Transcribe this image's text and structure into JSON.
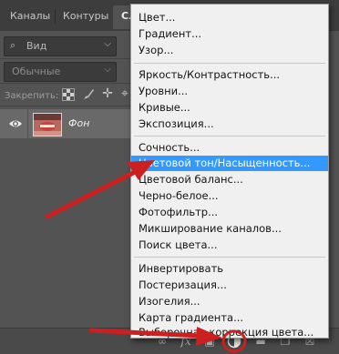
{
  "tabs": [
    "Каналы",
    "Контуры",
    "Сл"
  ],
  "filter": {
    "label": "Вид"
  },
  "blend_mode": {
    "value": "Обычные"
  },
  "lock": {
    "label": "Закрепить:"
  },
  "layer": {
    "name": "Фон"
  },
  "bottom_bar": {
    "fx_label": "fx"
  },
  "menu": {
    "items": [
      "Цвет...",
      "Градиент...",
      "Узор...",
      "Яркость/Контрастность...",
      "Уровни...",
      "Кривые...",
      "Экспозиция...",
      "Сочность...",
      "Цветовой тон/Насыщенность...",
      "Цветовой баланс...",
      "Черно-белое...",
      "Фотофильтр...",
      "Микширование каналов...",
      "Поиск цвета...",
      "Инвертировать",
      "Постеризация...",
      "Изогелия...",
      "Карта градиента...",
      "Выборочная коррекция цвета..."
    ],
    "highlighted": "Цветовой тон/Насыщенность..."
  },
  "colors": {
    "menu_highlight": "#3399ff",
    "annotation_red": "#cc1f1f"
  }
}
